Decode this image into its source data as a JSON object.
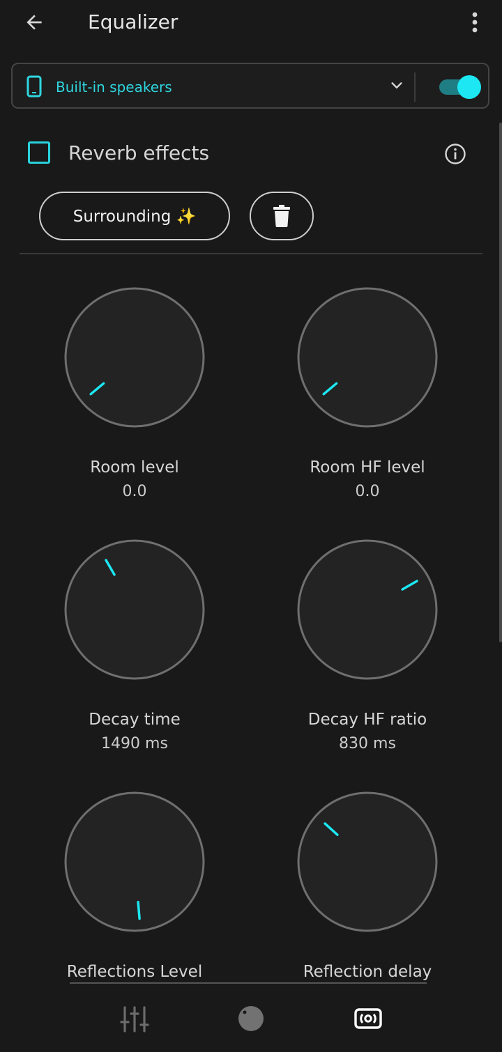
{
  "header": {
    "title": "Equalizer",
    "back_icon": "arrow-left-icon",
    "more_icon": "more-vert-icon"
  },
  "device": {
    "label": "Built-in speakers",
    "icon": "smartphone-icon",
    "enabled": true,
    "accent": "#1ce7f2"
  },
  "reverb": {
    "label": "Reverb effects",
    "checked": false,
    "preset_label": "Surrounding ✨",
    "delete_icon": "trash-icon",
    "info_icon": "info-icon"
  },
  "knobs": [
    {
      "label": "Room level",
      "value": "0.0",
      "indicator_angle_deg": 140
    },
    {
      "label": "Room HF level",
      "value": "0.0",
      "indicator_angle_deg": 140
    },
    {
      "label": "Decay time",
      "value": "1490 ms",
      "indicator_angle_deg": 240
    },
    {
      "label": "Decay HF ratio",
      "value": "830 ms",
      "indicator_angle_deg": 330
    },
    {
      "label": "Reflections Level",
      "value": "",
      "indicator_angle_deg": 85
    },
    {
      "label": "Reflection delay",
      "value": "",
      "indicator_angle_deg": 222
    }
  ],
  "bottom_nav": {
    "items": [
      {
        "icon": "equalizer-sliders-icon",
        "active": false
      },
      {
        "icon": "knob-icon",
        "active": false
      },
      {
        "icon": "reverb-icon",
        "active": true
      }
    ]
  }
}
